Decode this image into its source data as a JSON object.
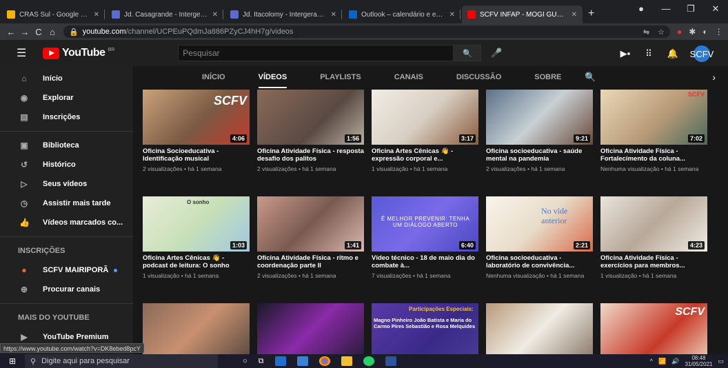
{
  "browser": {
    "tabs": [
      {
        "title": "CRAS Sul - Google Drive",
        "fav_color": "#f4b400",
        "active": false
      },
      {
        "title": "Jd. Casagrande - Intergeraciona",
        "fav_color": "#5b6bd0",
        "active": false
      },
      {
        "title": "Jd. Itacolomy - Intergeracional",
        "fav_color": "#5b6bd0",
        "active": false
      },
      {
        "title": "Outlook – calendário e email",
        "fav_color": "#0a64c8",
        "active": false
      },
      {
        "title": "SCFV INFAP - MOGI GUAÇU",
        "fav_color": "#ff0000",
        "active": true
      }
    ],
    "url_host": "youtube.com",
    "url_path": "/channel/UCPEuPQdmJa886PZyCJ4hH7g/videos"
  },
  "header": {
    "logo_text": "YouTube",
    "logo_region": "BR",
    "search_placeholder": "Pesquisar",
    "avatar_text": "SCFV"
  },
  "sidebar": {
    "main": [
      {
        "label": "Início",
        "icon": "home-icon",
        "glyph": "⌂"
      },
      {
        "label": "Explorar",
        "icon": "compass-icon",
        "glyph": "◉"
      },
      {
        "label": "Inscrições",
        "icon": "subscriptions-icon",
        "glyph": "▤"
      }
    ],
    "library": [
      {
        "label": "Biblioteca",
        "icon": "library-icon",
        "glyph": "▣"
      },
      {
        "label": "Histórico",
        "icon": "history-icon",
        "glyph": "↺"
      },
      {
        "label": "Seus vídeos",
        "icon": "your-videos-icon",
        "glyph": "▷"
      },
      {
        "label": "Assistir mais tarde",
        "icon": "watch-later-icon",
        "glyph": "◷"
      },
      {
        "label": "Vídeos marcados co...",
        "icon": "liked-icon",
        "glyph": "👍"
      }
    ],
    "subs_heading": "INSCRIÇÕES",
    "subs": [
      {
        "label": "SCFV MAIRIPORÃ",
        "icon": "channel-avatar-icon",
        "glyph": "●"
      },
      {
        "label": "Procurar canais",
        "icon": "plus-circle-icon",
        "glyph": "⊕"
      }
    ],
    "more_heading": "MAIS DO YOUTUBE",
    "more": [
      {
        "label": "YouTube Premium",
        "icon": "youtube-premium-icon",
        "glyph": "▶"
      }
    ]
  },
  "channel_tabs": [
    "INÍCIO",
    "VÍDEOS",
    "PLAYLISTS",
    "CANAIS",
    "DISCUSSÃO",
    "SOBRE"
  ],
  "active_tab": "VÍDEOS",
  "videos": [
    {
      "title": "Oficina Socioeducativa - Identificação musical",
      "meta": "2 visualizações • há 1 semana",
      "duration": "4:06",
      "bg": "linear-gradient(135deg,#c9a27a,#7a5a44 55%,#c23b2e)"
    },
    {
      "title": "Oficina Atividade Física - resposta desafio dos palitos",
      "meta": "2 visualizações • há 1 semana",
      "duration": "1:56",
      "bg": "linear-gradient(135deg,#8a6a58,#5a4a44 60%,#b8b0a0)"
    },
    {
      "title": "Oficina Artes Cênicas 👋 - expressão corporal e...",
      "meta": "1 visualização • há 1 semana",
      "duration": "3:17",
      "bg": "linear-gradient(135deg,#f0ece6,#d8cfc2 50%,#8a5a3e)"
    },
    {
      "title": "Oficina socioeducativa - saúde mental na pandemia",
      "meta": "2 visualizações • há 1 semana",
      "duration": "9:21",
      "bg": "linear-gradient(135deg,#5a7288,#c8d0d4 50%,#6a4a3a)"
    },
    {
      "title": "Oficina Atividade Física - Fortalecimento da coluna...",
      "meta": "Nenhuma visualização • há 1 semana",
      "duration": "7:02",
      "bg": "linear-gradient(135deg,#e8d8b8,#b89a78 55%,#4a6a5a)"
    },
    {
      "title": "Oficina Artes Cênicas 👋 - podcast de leitura: O sonho",
      "meta": "1 visualização • há 1 semana",
      "duration": "1:03",
      "bg": "linear-gradient(135deg,#e8ecd8,#c8e0b8 50%,#a0c8e0)"
    },
    {
      "title": "Oficina Atividade Física - ritmo e coordenação parte II",
      "meta": "2 visualizações • há 1 semana",
      "duration": "1:41",
      "bg": "linear-gradient(135deg,#c89a8a,#7a5a50 50%,#d8b8b0)"
    },
    {
      "title": "Vídeo técnico - 18 de maio dia do combate à...",
      "meta": "7 visualizações • há 1 semana",
      "duration": "6:40",
      "bg": "linear-gradient(135deg,#5a5ad8,#7a6ae8 50%,#4a48c0)"
    },
    {
      "title": "Oficina socioeducativa - laboratório de convivência...",
      "meta": "Nenhuma visualização • há 1 semana",
      "duration": "2:21",
      "bg": "linear-gradient(135deg,#f8f4ec,#e8dcc8 50%,#d86a4a)"
    },
    {
      "title": "Oficina Atividade Física - exercícios para membros...",
      "meta": "1 visualização • há 1 semana",
      "duration": "4:23",
      "bg": "linear-gradient(135deg,#e8e4dc,#b8a898 50%,#f0ece4)"
    },
    {
      "title": "",
      "meta": "",
      "duration": "",
      "bg": "linear-gradient(135deg,#8a6a58,#c89070 50%,#5a4a40)"
    },
    {
      "title": "",
      "meta": "",
      "duration": "",
      "bg": "linear-gradient(135deg,#1a1a2a,#8a2aa8 50%,#2a1a3a)"
    },
    {
      "title": "",
      "meta": "",
      "duration": "",
      "bg": "linear-gradient(135deg,#5a3aa8,#3a2a88 60%,#4a3a98)"
    },
    {
      "title": "",
      "meta": "",
      "duration": "",
      "bg": "linear-gradient(135deg,#b89a7a,#f0ece4 50%,#8a7a6a)"
    },
    {
      "title": "",
      "meta": "",
      "duration": "",
      "bg": "linear-gradient(135deg,#f0d8c8,#c83a2a 60%,#e8c8b0)"
    }
  ],
  "thumb_texts": {
    "scfv": "SCFV",
    "sonho": "O sonho",
    "quote": "É MELHOR PREVENIR: TENHA UM DIÁLOGO ABERTO",
    "no_video": "No víde anterior",
    "participacoes": "Participações Especiais:",
    "guests": "Magno Pinheiro João Batista e Maria do Carmo Pires Sebastião e Rosa Melquides"
  },
  "status_url": "https://www.youtube.com/watch?v=DK8ebed8pcY",
  "taskbar": {
    "search_placeholder": "Digite aqui para pesquisar",
    "time": "08:48",
    "date": "31/05/2021"
  }
}
